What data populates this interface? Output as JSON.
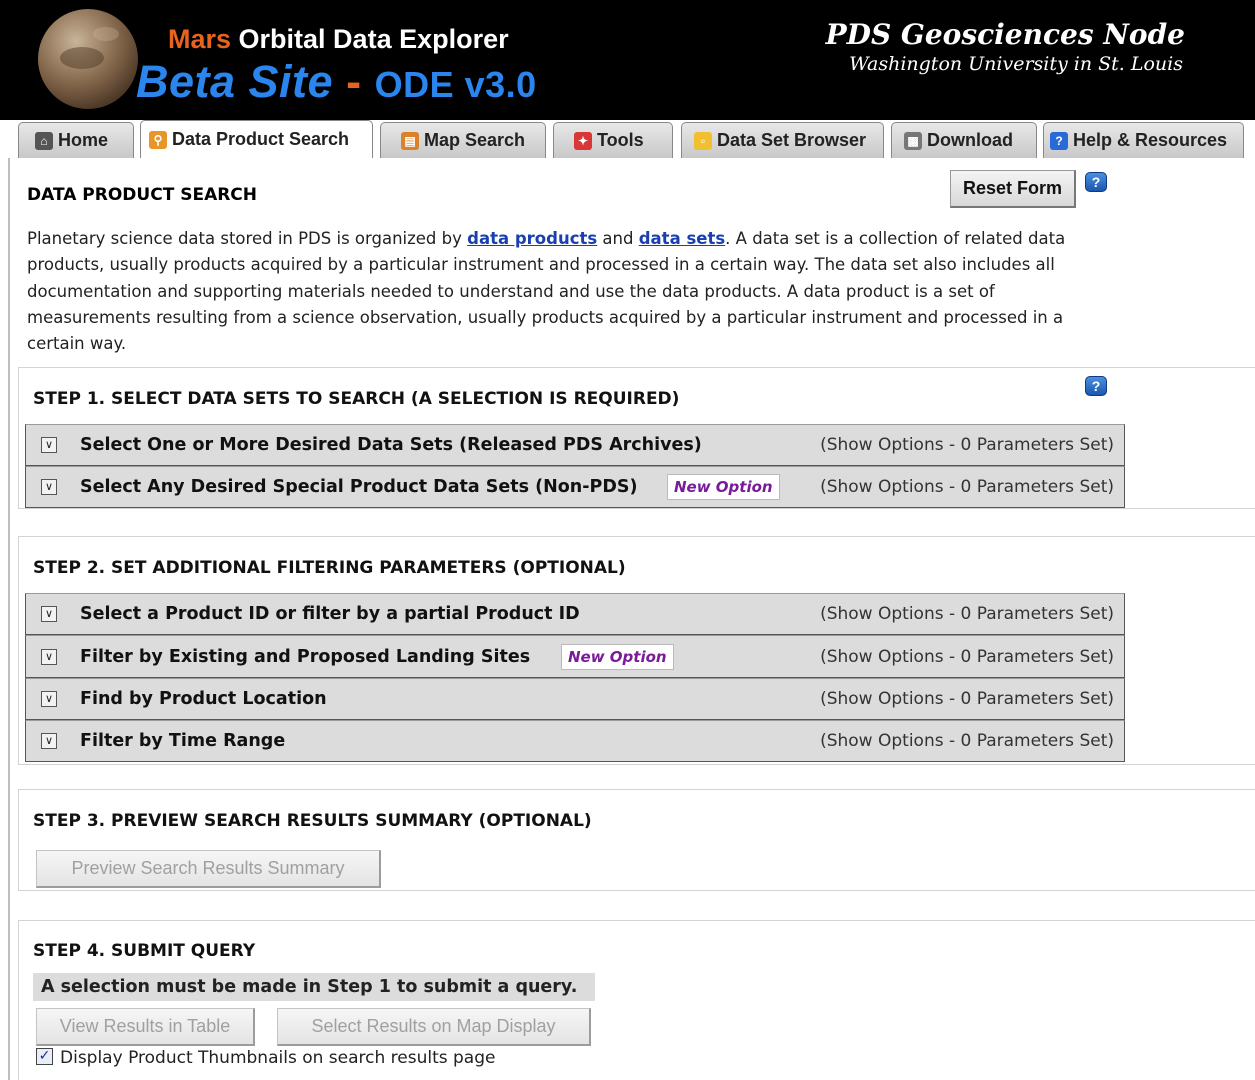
{
  "header": {
    "title_mars": "Mars",
    "title_rest": "Orbital Data Explorer",
    "beta": "Beta Site",
    "dash": "-",
    "version": "ODE v3.0",
    "node_name": "PDS Geosciences Node",
    "node_institution": "Washington University in St. Louis"
  },
  "tabs": [
    {
      "label": "Home",
      "icon": "home-icon",
      "active": false
    },
    {
      "label": "Data Product Search",
      "icon": "search-icon",
      "active": true
    },
    {
      "label": "Map Search",
      "icon": "map-icon",
      "active": false
    },
    {
      "label": "Tools",
      "icon": "tools-icon",
      "active": false
    },
    {
      "label": "Data Set Browser",
      "icon": "folder-icon",
      "active": false
    },
    {
      "label": "Download",
      "icon": "download-icon",
      "active": false
    },
    {
      "label": "Help & Resources",
      "icon": "help-icon",
      "active": false
    }
  ],
  "page": {
    "title": "DATA PRODUCT SEARCH",
    "reset_label": "Reset Form",
    "help_glyph": "?",
    "intro_before": "Planetary science data stored in PDS is organized by ",
    "link_products": "data products",
    "intro_and": " and ",
    "link_sets": "data sets",
    "intro_after": ". A data set is a collection of related data products, usually products acquired by a particular instrument and processed in a certain way. The data set also includes all documentation and supporting materials needed to understand and use the data products. A data product is a set of measurements resulting from a science observation, usually products acquired by a particular instrument and processed in a certain way."
  },
  "step1": {
    "title": "STEP 1. SELECT DATA SETS TO SEARCH (A SELECTION IS REQUIRED)",
    "rows": [
      {
        "label": "Select One or More Desired Data Sets (Released PDS Archives)",
        "status": "(Show Options - 0 Parameters Set)"
      },
      {
        "label": "Select Any Desired Special Product Data Sets (Non-PDS)",
        "status": "(Show Options - 0 Parameters Set)",
        "badge": "New Option"
      }
    ]
  },
  "step2": {
    "title": "STEP 2. SET ADDITIONAL FILTERING PARAMETERS (OPTIONAL)",
    "rows": [
      {
        "label": "Select a Product ID or filter by a partial Product ID",
        "status": "(Show Options - 0 Parameters Set)"
      },
      {
        "label": "Filter by Existing and Proposed Landing Sites",
        "status": "(Show Options - 0 Parameters Set)",
        "badge": "New Option"
      },
      {
        "label": "Find by Product Location",
        "status": "(Show Options - 0 Parameters Set)"
      },
      {
        "label": "Filter by Time Range",
        "status": "(Show Options - 0 Parameters Set)"
      }
    ]
  },
  "step3": {
    "title": "STEP 3. PREVIEW SEARCH RESULTS SUMMARY (OPTIONAL)",
    "button": "Preview Search Results Summary"
  },
  "step4": {
    "title": "STEP 4. SUBMIT QUERY",
    "warning": "A selection must be made in Step 1 to submit a query.",
    "table_button": "View Results in Table",
    "map_button": "Select Results on Map Display",
    "checkbox_label": "Display Product Thumbnails on search results page",
    "checkbox_checked": true
  }
}
